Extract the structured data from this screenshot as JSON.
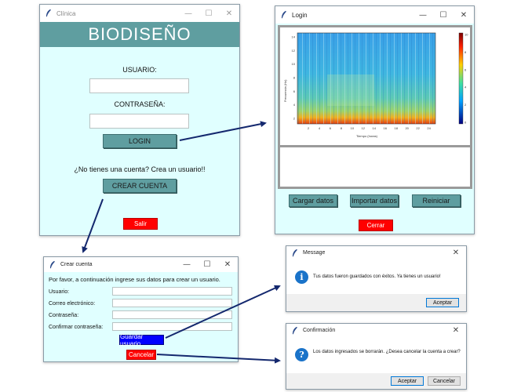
{
  "clinica": {
    "window_title": "Clínica",
    "controls": [
      "—",
      "☐",
      "✕"
    ],
    "banner": "BIODISEÑO",
    "usuario_label": "USUARIO:",
    "contrasena_label": "CONTRASEÑA:",
    "login_button": "LOGIN",
    "no_account_text": "¿No tienes una cuenta? Crea un usuario!!",
    "crear_cuenta_button": "CREAR CUENTA",
    "salir_button": "Salir"
  },
  "login": {
    "window_title": "Login",
    "controls": [
      "—",
      "☐",
      "✕"
    ],
    "spectrogram": {
      "ylabel": "Frecuencia (Hz)",
      "xlabel": "Tiempo (horas)",
      "y_ticks": [
        "14",
        "12",
        "10",
        "8",
        "6",
        "4",
        "2"
      ],
      "x_ticks": [
        "2",
        "4",
        "6",
        "8",
        "10",
        "12",
        "14",
        "16",
        "18",
        "20",
        "22",
        "24"
      ],
      "colorbar_ticks": [
        "10",
        "8",
        "6",
        "4",
        "2",
        "0"
      ]
    },
    "cargar_button": "Cargar datos",
    "importar_button": "Importar datos",
    "reiniciar_button": "Reiniciar",
    "cerrar_button": "Cerrar"
  },
  "crear": {
    "window_title": "Crear cuenta",
    "controls": [
      "—",
      "☐",
      "✕"
    ],
    "instructions": "Por favor, a continuación ingrese sus datos para crear un usuario.",
    "fields": [
      "Usuario:",
      "Correo electrónico:",
      "Contraseña:",
      "Confirmar contraseña:"
    ],
    "guardar_button": "Guardar usuario",
    "cancelar_button": "Cancelar"
  },
  "message": {
    "window_title": "Message",
    "close": "✕",
    "icon": "info-icon",
    "text": "Tus datos fueron guardados con éxitos. Ya tienes un usuario!",
    "aceptar_button": "Aceptar"
  },
  "confirmacion": {
    "window_title": "Confirmación",
    "close": "✕",
    "icon": "question-icon",
    "text": "Los datos ingresados se borrarán. ¿Desea cancelar la cuenta a crear?",
    "aceptar_button": "Aceptar",
    "cancelar_button": "Cancelar"
  },
  "colors": {
    "window_bg": "#e0ffff",
    "banner_bg": "#5f9ea0",
    "button_bg": "#5f9ea0",
    "red": "#ff0000",
    "blue": "#0000ff",
    "arrow": "#14286e"
  }
}
